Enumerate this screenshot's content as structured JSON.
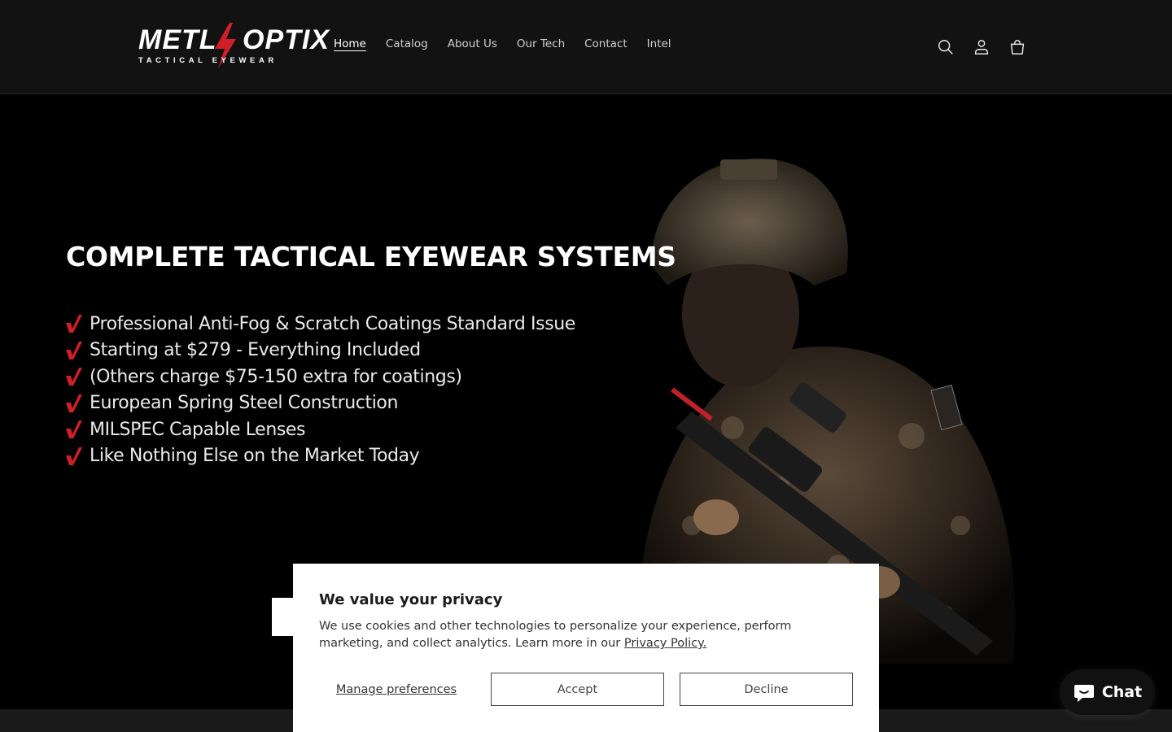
{
  "brand": {
    "logo_text_left": "METL",
    "logo_text_right": "OPTIX",
    "logo_tagline": "TACTICAL EYEWEAR",
    "accent_color": "#d11f2a"
  },
  "nav": {
    "items": [
      {
        "label": "Home",
        "active": true
      },
      {
        "label": "Catalog"
      },
      {
        "label": "About Us"
      },
      {
        "label": "Our Tech"
      },
      {
        "label": "Contact"
      },
      {
        "label": "Intel"
      }
    ]
  },
  "header_icons": [
    "search-icon",
    "account-icon",
    "cart-icon"
  ],
  "hero": {
    "title": "COMPLETE TACTICAL EYEWEAR SYSTEMS",
    "features": [
      "Professional Anti-Fog & Scratch Coatings Standard Issue",
      "Starting at $279 - Everything Included",
      "(Others charge $75-150 extra for coatings)",
      "European Spring Steel Construction",
      "MILSPEC Capable Lenses",
      "Like Nothing Else on the Market Today"
    ]
  },
  "privacy": {
    "title": "We value your privacy",
    "body": "We use cookies and other technologies to personalize your experience, perform marketing, and collect analytics. Learn more in our ",
    "link": "Privacy Policy.",
    "manage_label": "Manage preferences",
    "accept_label": "Accept",
    "decline_label": "Decline"
  },
  "chat": {
    "label": "Chat"
  }
}
